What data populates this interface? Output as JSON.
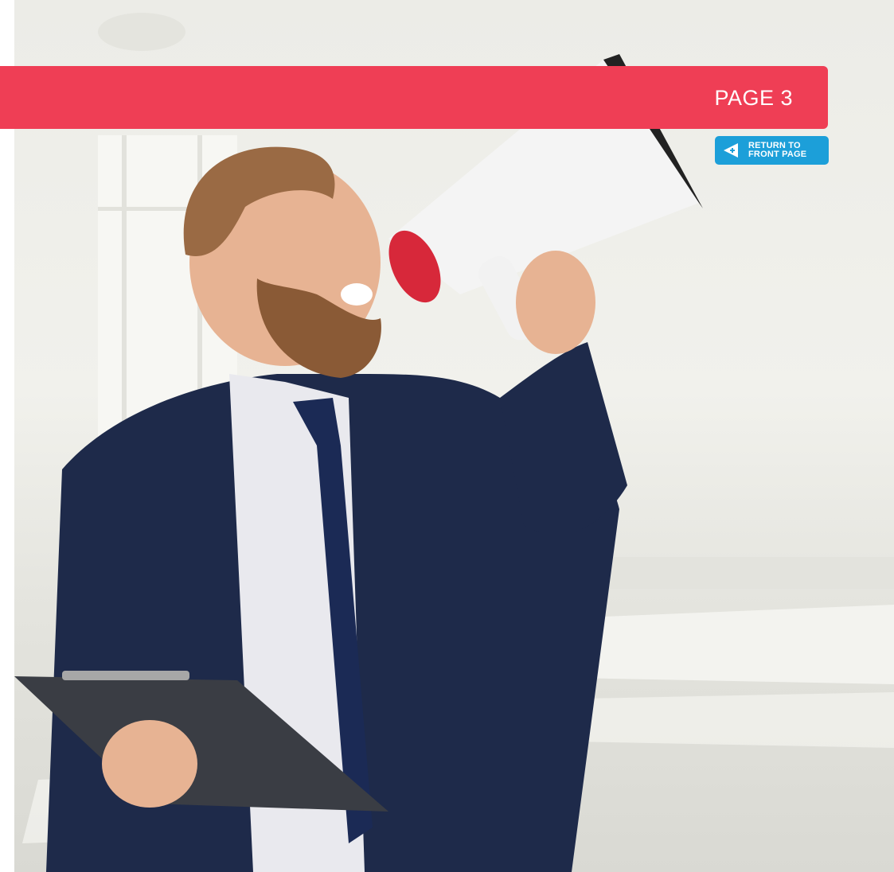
{
  "banner": {
    "label": "PAGE 3",
    "color": "#ef3e55"
  },
  "return_button": {
    "line1": "RETURN TO",
    "line2": "FRONT PAGE",
    "color": "#1c9fd9",
    "icon": "back-arrow-icon"
  },
  "hero": {
    "subject": "businessman-with-megaphone-photo"
  }
}
